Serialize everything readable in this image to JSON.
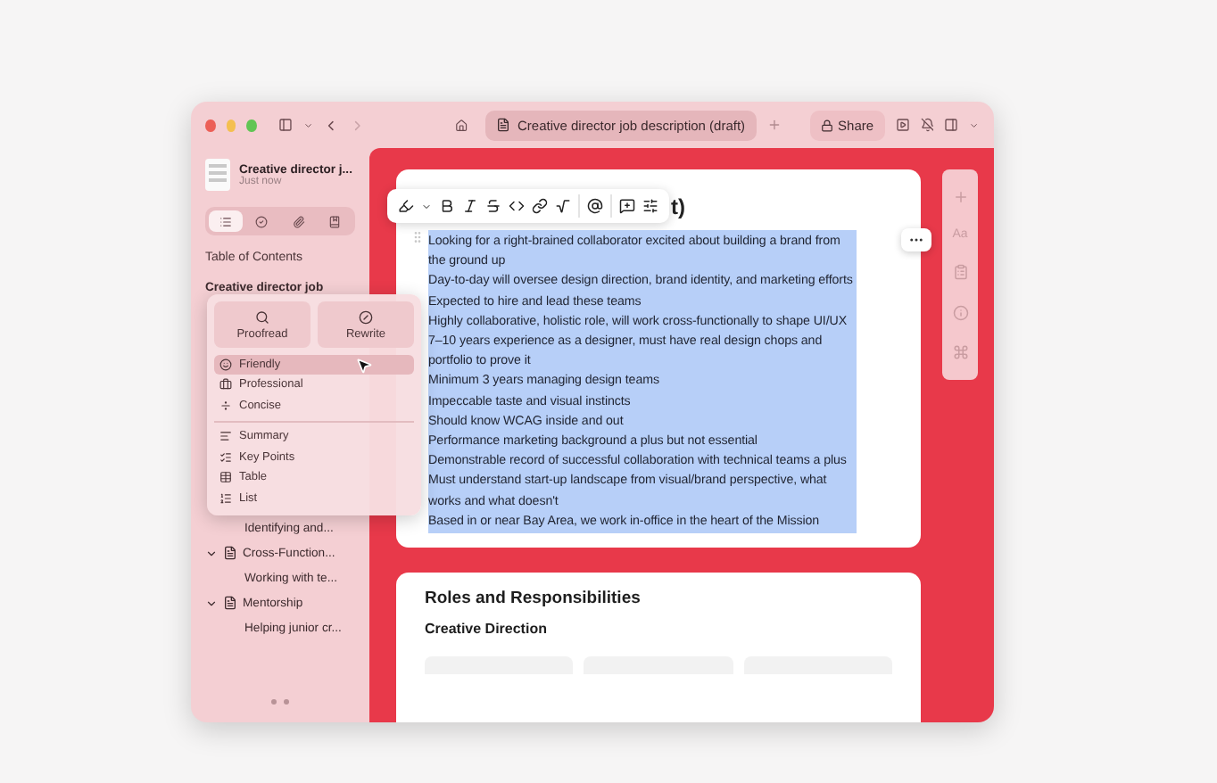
{
  "window": {
    "tab_title": "Creative director job description (draft)",
    "share": "Share"
  },
  "sidebar": {
    "doc_title": "Creative director j...",
    "doc_time": "Just now",
    "views": [
      {
        "kind": "list",
        "selected": true
      },
      {
        "kind": "check",
        "selected": false
      },
      {
        "kind": "clip",
        "selected": false
      },
      {
        "kind": "bookmark",
        "selected": false
      }
    ],
    "toc_heading": "Table of Contents",
    "toc": [
      {
        "label": "Creative director job",
        "children": [
          {
            "label": "Identifying and..."
          },
          {
            "label": "Cross-Function...",
            "expanded": true,
            "children": [
              {
                "label": "Working with te..."
              }
            ]
          },
          {
            "label": "Mentorship",
            "expanded": true,
            "children": [
              {
                "label": "Helping junior cr..."
              }
            ]
          }
        ]
      }
    ]
  },
  "ai_menu": {
    "actions": [
      {
        "kind": "proofread",
        "label": "Proofread"
      },
      {
        "kind": "rewrite",
        "label": "Rewrite"
      }
    ],
    "tones": [
      {
        "kind": "smile",
        "label": "Friendly",
        "selected": true
      },
      {
        "kind": "briefcase",
        "label": "Professional",
        "selected": false
      },
      {
        "kind": "concise",
        "label": "Concise",
        "selected": false
      }
    ],
    "formats": [
      {
        "kind": "summary",
        "label": "Summary"
      },
      {
        "kind": "points",
        "label": "Key Points"
      },
      {
        "kind": "table",
        "label": "Table"
      },
      {
        "kind": "list",
        "label": "List"
      }
    ]
  },
  "editor": {
    "title_visible": "t)",
    "lines": [
      "Looking for a right-brained collaborator excited about building a brand from the ground up",
      "Day-to-day will oversee design direction, brand identity, and marketing efforts",
      "Expected to hire and lead these teams",
      "Highly collaborative, holistic role, will work cross-functionally to shape UI/UX",
      "7–10 years experience as a designer, must have real design chops and portfolio to prove it",
      "Minimum 3 years managing design teams",
      "Impeccable taste and visual instincts",
      "Should know WCAG inside and out",
      "Performance marketing background a plus but not essential",
      "Demonstrable record of successful collaboration with technical teams a plus",
      "Must understand start-up landscape from visual/brand perspective, what works and what doesn't",
      "Based in or near Bay Area, we work in-office in the heart of the Mission"
    ],
    "section_title": "Roles and Responsibilities",
    "subsection_title": "Creative Direction"
  },
  "rail": {
    "font_label": "Aa"
  }
}
